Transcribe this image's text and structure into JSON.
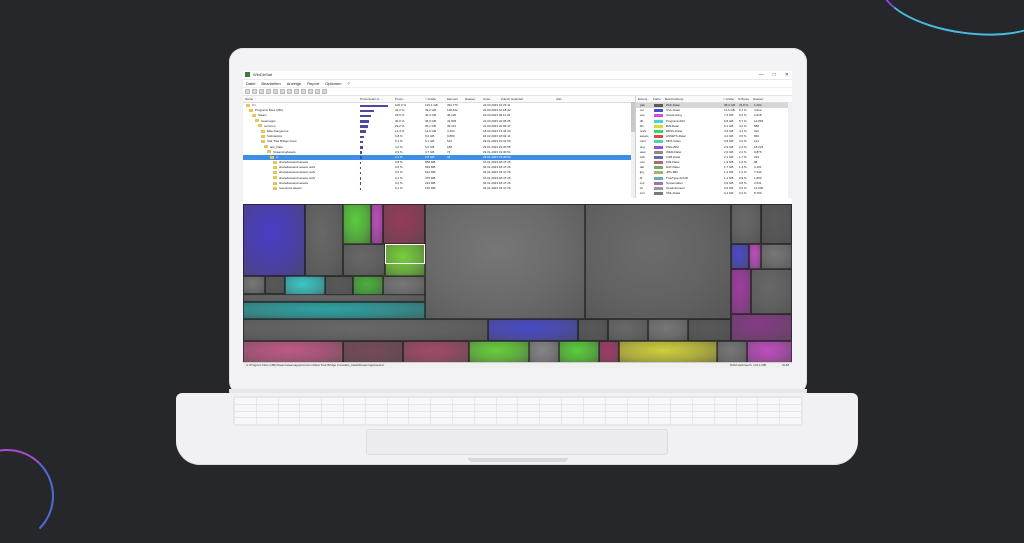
{
  "window": {
    "title": "WinDirStat",
    "controls": [
      "—",
      "□",
      "✕"
    ]
  },
  "menu": [
    "Datei",
    "Bearbeiten",
    "Anzeige",
    "Report",
    "Optionen",
    "?"
  ],
  "tree": {
    "columns": [
      "Name",
      "Prozentsatz (z. ...",
      "Proze...",
      "> Größe",
      "Element",
      "Dateien",
      "Unter...",
      "Zuletzt Geändert",
      "Attri..."
    ],
    "rows": [
      {
        "name": "C:\\",
        "pct": "100,0 %",
        "size": "120,1 GB",
        "files": "394.776",
        "modified": "22.03.2023 10:23:11"
      },
      {
        "name": "Programs Files (x86)",
        "pct": "41,0 %",
        "size": "49,2 GB",
        "files": "118.432",
        "modified": "22.03.2023 10:18:42"
      },
      {
        "name": "Steam",
        "pct": "33,6 %",
        "size": "40,3 GB",
        "files": "46.120",
        "modified": "22.03.2023 09:11:34"
      },
      {
        "name": "steamapps",
        "pct": "30,0 %",
        "size": "36,0 GB",
        "files": "41.893",
        "modified": "21.03.2023 22:06:05"
      },
      {
        "name": "common",
        "pct": "29,2 %",
        "size": "35,1 GB",
        "files": "39.114",
        "modified": "21.03.2023 22:05:47"
      },
      {
        "name": "Elite Dangerous",
        "pct": "12,4 %",
        "size": "14,9 GB",
        "files": "3.204",
        "modified": "18.02.2023 13:44:20"
      },
      {
        "name": "Subnautica",
        "pct": "6,8 %",
        "size": "8,2 GB",
        "files": "9.880",
        "modified": "04.02.2023 18:02:11"
      },
      {
        "name": "Star Trek Bridge Crew",
        "pct": "5,1 %",
        "size": "6,1 GB",
        "files": "512",
        "modified": "29.01.2023 19:31:06"
      },
      {
        "name": "ahc_Data",
        "pct": "4,2 %",
        "size": "5,0 GB",
        "files": "188",
        "modified": "29.01.2023 19:30:55"
      },
      {
        "name": "StreamingAssets",
        "pct": "3,9 %",
        "size": "4,7 GB",
        "files": "74",
        "modified": "29.01.2023 19:30:54"
      },
      {
        "name": "vr",
        "pct": "2,1 %",
        "size": "2,5 GB",
        "files": "32",
        "modified": "29.01.2023 19:30:54"
      },
      {
        "name": "sharedassets0.assets",
        "pct": "0,8 %",
        "size": "958 MB",
        "files": "",
        "modified": "04.01.2023 18:47:26"
      },
      {
        "name": "sharedassets1.assets.resS",
        "pct": "0,6 %",
        "size": "693 MB",
        "files": "",
        "modified": "04.01.2023 18:47:26"
      },
      {
        "name": "sharedassets2.assets.resS",
        "pct": "0,5 %",
        "size": "612 MB",
        "files": "",
        "modified": "04.01.2023 18:47:26"
      },
      {
        "name": "sharedassets3.assets.resS",
        "pct": "0,4 %",
        "size": "475 MB",
        "files": "",
        "modified": "04.01.2023 18:47:26"
      },
      {
        "name": "sharedassets4.assets",
        "pct": "0,2 %",
        "size": "224 MB",
        "files": "",
        "modified": "04.01.2023 18:47:26"
      },
      {
        "name": "resources.assets",
        "pct": "0,1 %",
        "size": "152 MB",
        "files": "",
        "modified": "04.01.2023 18:47:26"
      }
    ]
  },
  "extensions": {
    "columns": [
      "Extens...",
      "Farbe",
      "Beschreibung",
      "> Größe",
      "% Bytes",
      "Dateien"
    ],
    "rows": [
      {
        "ext": ".pak",
        "desc": "PAK-Datei",
        "bytes": "38,2 GB",
        "pct": "31,8 %",
        "files": "1.204",
        "color": "#5b5b5b"
      },
      {
        "ext": ".ovl",
        "desc": "OVL-Datei",
        "bytes": "11,6 GB",
        "pct": "9,7 %",
        "files": "3.512",
        "color": "#4c4cd8"
      },
      {
        "ext": ".exe",
        "desc": "Anwendung",
        "bytes": "7,2 GB",
        "pct": "6,0 %",
        "files": "2.018",
        "color": "#d84cd8"
      },
      {
        "ext": ".dll",
        "desc": "Programmbibl.",
        "bytes": "6,8 GB",
        "pct": "5,7 %",
        "files": "14.893",
        "color": "#3ad8d8"
      },
      {
        "ext": ".bin",
        "desc": "BIN-Datei",
        "bytes": "5,1 GB",
        "pct": "4,2 %",
        "files": "688",
        "color": "#d8d83a"
      },
      {
        "ext": ".resS",
        "desc": "RESS-Datei",
        "bytes": "4,9 GB",
        "pct": "4,1 %",
        "files": "312",
        "color": "#3ad84c"
      },
      {
        "ext": ".assets",
        "desc": "ASSETS-Datei",
        "bytes": "4,2 GB",
        "pct": "3,5 %",
        "files": "846",
        "color": "#d84c4c"
      },
      {
        "ext": ".mp4",
        "desc": "MP4-Video",
        "bytes": "3,8 GB",
        "pct": "3,2 %",
        "files": "121",
        "color": "#4cd8a0"
      },
      {
        "ext": ".png",
        "desc": "PNG-Bild",
        "bytes": "2,9 GB",
        "pct": "2,4 %",
        "files": "18.223",
        "color": "#a04cd8"
      },
      {
        "ext": ".wem",
        "desc": "WEM-Datei",
        "bytes": "2,6 GB",
        "pct": "2,2 %",
        "files": "9.876",
        "color": "#8a8a8a"
      },
      {
        "ext": ".cab",
        "desc": "CAB-Datei",
        "bytes": "2,1 GB",
        "pct": "1,7 %",
        "files": "233",
        "color": "#6a6ab0"
      },
      {
        "ext": ".msi",
        "desc": "MSI-Datei",
        "bytes": "1,9 GB",
        "pct": "1,6 %",
        "files": "98",
        "color": "#b06a6a"
      },
      {
        "ext": ".dat",
        "desc": "DAT-Datei",
        "bytes": "1,7 GB",
        "pct": "1,4 %",
        "files": "4.101",
        "color": "#6ab06a"
      },
      {
        "ext": ".jpg",
        "desc": "JPG-Bild",
        "bytes": "1,4 GB",
        "pct": "1,2 %",
        "files": "7.342",
        "color": "#b0b06a"
      },
      {
        "ext": ".ttf",
        "desc": "TrueType-Schrift",
        "bytes": "1,1 GB",
        "pct": "0,9 %",
        "files": "1.890",
        "color": "#6ab0b0"
      },
      {
        "ext": ".sys",
        "desc": "Systemdatei",
        "bytes": "0,9 GB",
        "pct": "0,8 %",
        "files": "2.541",
        "color": "#b06ab0"
      },
      {
        "ext": ".txt",
        "desc": "Textdokument",
        "bytes": "0,6 GB",
        "pct": "0,5 %",
        "files": "12.006",
        "color": "#9a9a9a"
      },
      {
        "ext": ".xml",
        "desc": "XML-Datei",
        "bytes": "0,4 GB",
        "pct": "0,3 %",
        "files": "8.790",
        "color": "#7a7a7a"
      }
    ]
  },
  "status": {
    "path": "C:\\Program Files (x86)\\Steam\\steamapps\\common\\Star Trek Bridge Crew\\ahc_Data\\StreamingAssets\\vr",
    "ram": "RAM-Verbrauch: 142,1 MB",
    "num": "NUM"
  },
  "colors": {
    "selection": "#3d8ee6",
    "treemap_bg": "#4a4a4a",
    "highlight": "#ffffff"
  }
}
